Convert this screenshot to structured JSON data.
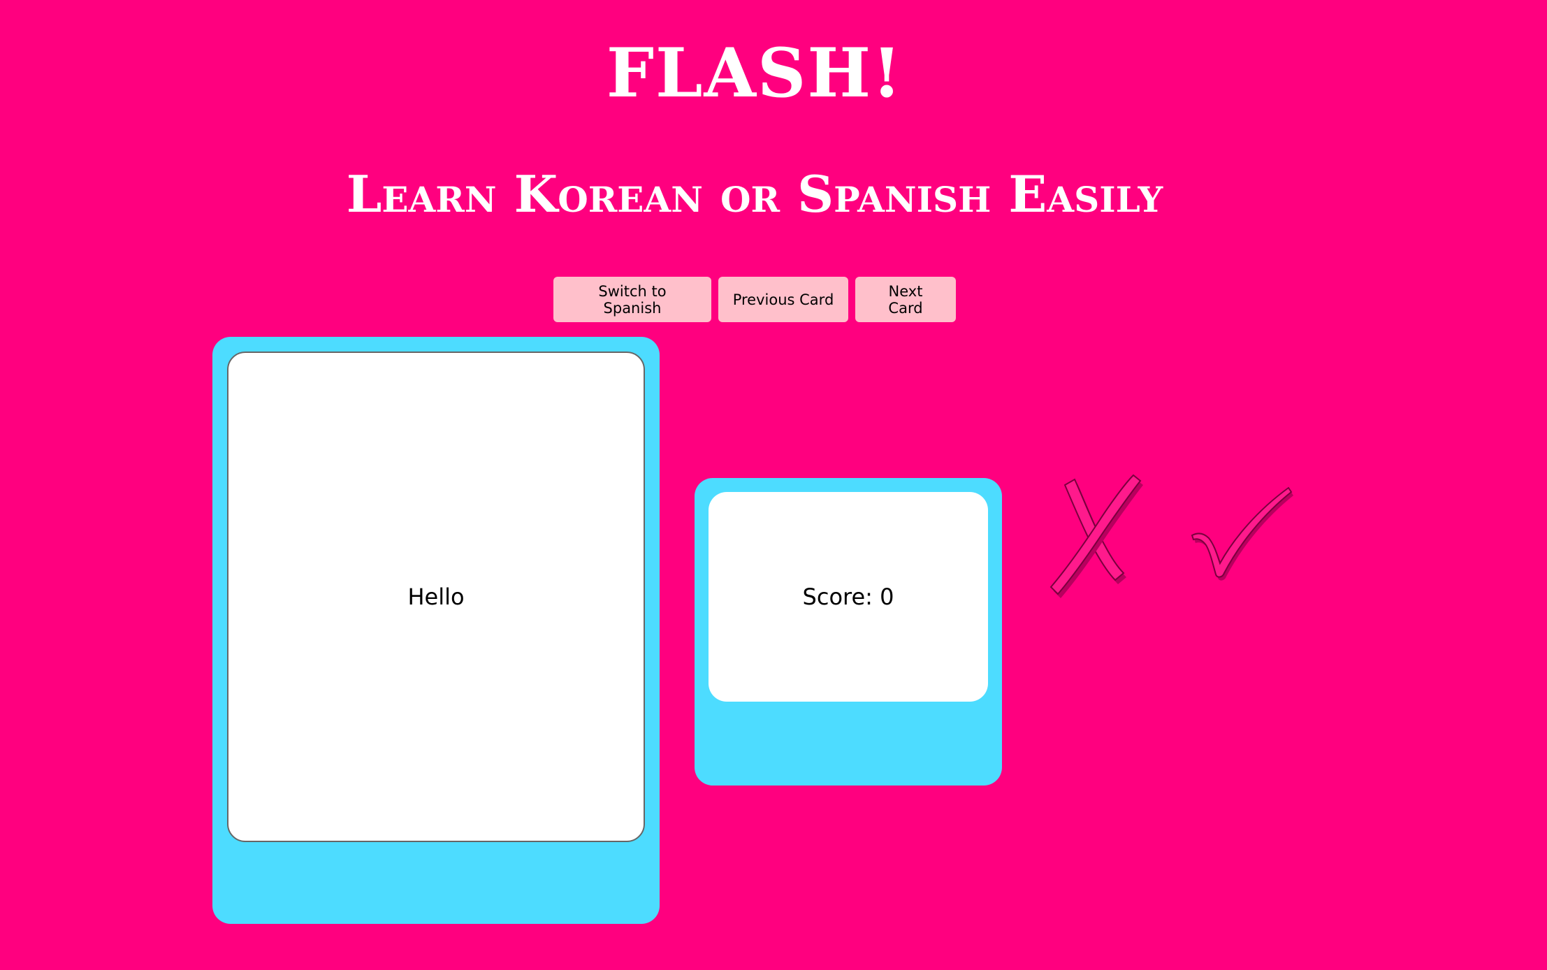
{
  "header": {
    "title": "FLASH!",
    "subtitle": "Learn Korean or Spanish Easily"
  },
  "controls": {
    "switch_label": "Switch to Spanish",
    "previous_label": "Previous Card",
    "next_label": "Next Card"
  },
  "flashcard": {
    "word": "Hello"
  },
  "score": {
    "text": "Score: 0"
  },
  "marks": {
    "wrong_icon": "x-icon",
    "right_icon": "check-icon"
  },
  "colors": {
    "background": "#ff007f",
    "card_frame": "#4ddcff",
    "button": "#ffc0cb",
    "card_face": "#ffffff"
  }
}
